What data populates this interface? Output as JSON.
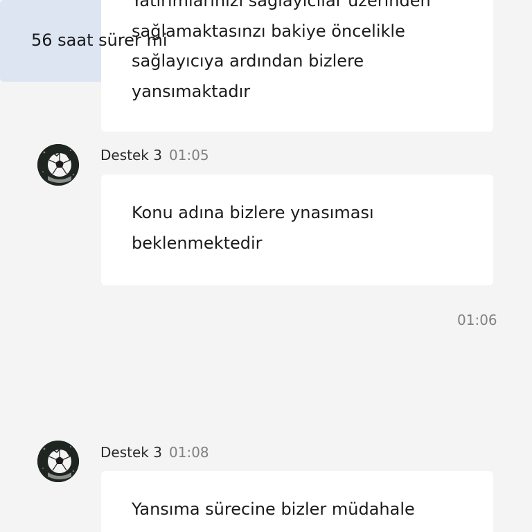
{
  "messages": [
    {
      "type": "incoming",
      "lines": "Yatırımlarınızı sağlayıcılar üzerinden\nsağlamaktasınzı bakiye öncelikle\nsağlayıcıya ardından bizlere\nyansımaktadır"
    },
    {
      "type": "incoming",
      "sender": "Destek 3",
      "time": "01:05",
      "avatar_icon": "soccer-ball-icon",
      "lines": "Konu adına bizlere ynasıması\nbeklenmektedir"
    },
    {
      "type": "outgoing",
      "time": "01:06",
      "text": "56 saat sürer mi"
    },
    {
      "type": "incoming",
      "sender": "Destek 3",
      "time": "01:08",
      "avatar_icon": "soccer-ball-icon",
      "lines": "Yansıma sürecine bizler müdahale"
    }
  ],
  "colors": {
    "background": "#f4f4f4",
    "incoming_bubble": "#ffffff",
    "outgoing_bubble": "#dde4f2",
    "time_text": "#808080"
  }
}
